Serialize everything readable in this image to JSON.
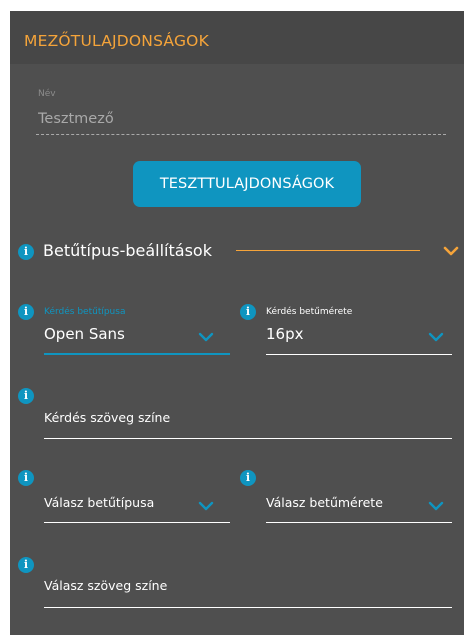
{
  "header": {
    "title": "MEZŐTULAJDONSÁGOK"
  },
  "name_field": {
    "label": "Név",
    "value": "Tesztmező"
  },
  "test_button": {
    "label": "TESZTTULAJDONSÁGOK"
  },
  "section": {
    "title": "Betűtípus-beállítások",
    "expanded": true
  },
  "fields": {
    "question_font": {
      "label": "Kérdés betűtípusa",
      "value": "Open Sans",
      "focused": true
    },
    "question_size": {
      "label": "Kérdés betűmérete",
      "value": "16px"
    },
    "question_color": {
      "label": "Kérdés szöveg színe"
    },
    "answer_font": {
      "label": "Válasz betűtípusa"
    },
    "answer_size": {
      "label": "Válasz betűmérete"
    },
    "answer_color": {
      "label": "Válasz szöveg színe"
    }
  },
  "icons": {
    "info": "info-icon",
    "chevron": "chevron-down-icon"
  },
  "colors": {
    "panel_bg": "#4f4f4f",
    "header_bg": "#474747",
    "accent_orange": "#f5a43a",
    "accent_blue": "#0f95c0",
    "text": "#ffffff",
    "muted": "#a9a9a9"
  }
}
